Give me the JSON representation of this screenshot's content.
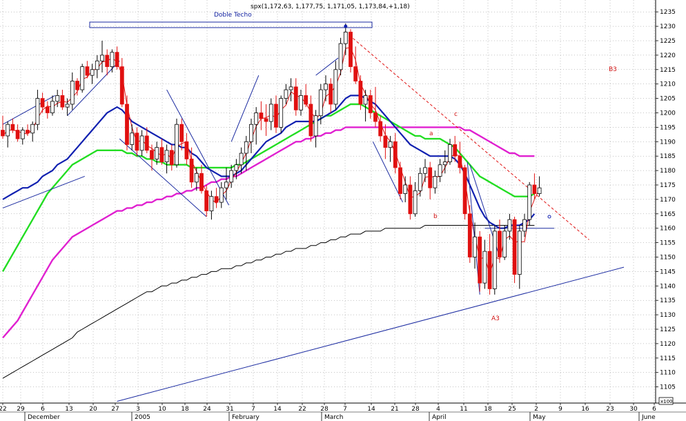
{
  "chart_data": {
    "type": "candlestick",
    "title": "spx(1,172,63, 1,177,75, 1,171,05, 1,173,84,+1,18)",
    "pattern_label": "Doble Techo",
    "ylim": [
      1100,
      1240
    ],
    "y_ticks": [
      1105,
      1110,
      1115,
      1120,
      1125,
      1130,
      1135,
      1140,
      1145,
      1150,
      1155,
      1160,
      1165,
      1170,
      1175,
      1180,
      1185,
      1190,
      1195,
      1200,
      1205,
      1210,
      1215,
      1220,
      1225,
      1230,
      1235
    ],
    "x_day_ticks": [
      "22",
      "29",
      "6",
      "13",
      "20",
      "27",
      "3",
      "10",
      "18",
      "24",
      "31",
      "7",
      "14",
      "22",
      "28",
      "7",
      "14",
      "21",
      "28",
      "4",
      "11",
      "18",
      "25",
      "2",
      "9",
      "16",
      "23",
      "30",
      "6"
    ],
    "x_month_labels": [
      "December",
      "2005",
      "February",
      "March",
      "April",
      "May",
      "June"
    ],
    "scale_box": "x100",
    "annotations": [
      {
        "text": "B3",
        "color": "red"
      },
      {
        "text": "c",
        "color": "red"
      },
      {
        "text": "a",
        "color": "red"
      },
      {
        "text": "b",
        "color": "red"
      },
      {
        "text": "A3",
        "color": "red"
      }
    ],
    "colors": {
      "bear_candle": "#e01010",
      "bull_candle": "#ffffff",
      "ma_fast": "#e01010",
      "ma_blue": "#1020b0",
      "ma_green": "#22dd22",
      "ma_magenta": "#e020d0",
      "ma_black": "#000000",
      "trendline": "#1a2aa0",
      "resistance": "#e01010"
    },
    "candles": [
      [
        1194,
        1199,
        1191,
        1192
      ],
      [
        1192,
        1197,
        1188,
        1196
      ],
      [
        1196,
        1198,
        1193,
        1194
      ],
      [
        1194,
        1196,
        1190,
        1191
      ],
      [
        1191,
        1195,
        1189,
        1194
      ],
      [
        1194,
        1196,
        1192,
        1193
      ],
      [
        1193,
        1197,
        1190,
        1196
      ],
      [
        1196,
        1208,
        1194,
        1205
      ],
      [
        1205,
        1207,
        1200,
        1202
      ],
      [
        1202,
        1204,
        1198,
        1200
      ],
      [
        1200,
        1206,
        1199,
        1204
      ],
      [
        1204,
        1208,
        1202,
        1206
      ],
      [
        1206,
        1208,
        1201,
        1202
      ],
      [
        1202,
        1205,
        1199,
        1203
      ],
      [
        1203,
        1214,
        1201,
        1211
      ],
      [
        1211,
        1212,
        1206,
        1208
      ],
      [
        1208,
        1217,
        1207,
        1216
      ],
      [
        1216,
        1218,
        1212,
        1213
      ],
      [
        1213,
        1217,
        1210,
        1215
      ],
      [
        1215,
        1220,
        1212,
        1218
      ],
      [
        1218,
        1225,
        1214,
        1220
      ],
      [
        1220,
        1222,
        1213,
        1216
      ],
      [
        1216,
        1222,
        1214,
        1221
      ],
      [
        1221,
        1223,
        1215,
        1216
      ],
      [
        1216,
        1219,
        1202,
        1203
      ],
      [
        1203,
        1206,
        1187,
        1189
      ],
      [
        1189,
        1196,
        1187,
        1193
      ],
      [
        1193,
        1195,
        1185,
        1187
      ],
      [
        1187,
        1194,
        1185,
        1192
      ],
      [
        1192,
        1195,
        1186,
        1187
      ],
      [
        1187,
        1189,
        1180,
        1184
      ],
      [
        1184,
        1190,
        1182,
        1188
      ],
      [
        1188,
        1191,
        1182,
        1183
      ],
      [
        1183,
        1189,
        1179,
        1187
      ],
      [
        1187,
        1189,
        1180,
        1182
      ],
      [
        1182,
        1198,
        1181,
        1196
      ],
      [
        1196,
        1198,
        1187,
        1190
      ],
      [
        1190,
        1193,
        1182,
        1184
      ],
      [
        1184,
        1188,
        1174,
        1176
      ],
      [
        1176,
        1181,
        1173,
        1179
      ],
      [
        1179,
        1182,
        1172,
        1173
      ],
      [
        1173,
        1175,
        1164,
        1166
      ],
      [
        1166,
        1173,
        1163,
        1171
      ],
      [
        1171,
        1174,
        1167,
        1169
      ],
      [
        1169,
        1176,
        1167,
        1174
      ],
      [
        1174,
        1181,
        1170,
        1176
      ],
      [
        1176,
        1182,
        1174,
        1180
      ],
      [
        1180,
        1184,
        1177,
        1182
      ],
      [
        1182,
        1188,
        1179,
        1186
      ],
      [
        1186,
        1192,
        1180,
        1190
      ],
      [
        1190,
        1198,
        1186,
        1196
      ],
      [
        1196,
        1202,
        1189,
        1200
      ],
      [
        1200,
        1204,
        1194,
        1198
      ],
      [
        1198,
        1203,
        1192,
        1197
      ],
      [
        1197,
        1205,
        1194,
        1203
      ],
      [
        1203,
        1206,
        1193,
        1195
      ],
      [
        1195,
        1206,
        1193,
        1205
      ],
      [
        1205,
        1210,
        1203,
        1208
      ],
      [
        1208,
        1212,
        1204,
        1209
      ],
      [
        1209,
        1212,
        1199,
        1201
      ],
      [
        1201,
        1208,
        1199,
        1206
      ],
      [
        1206,
        1210,
        1202,
        1203
      ],
      [
        1203,
        1206,
        1190,
        1192
      ],
      [
        1192,
        1201,
        1188,
        1199
      ],
      [
        1199,
        1210,
        1196,
        1208
      ],
      [
        1208,
        1213,
        1204,
        1210
      ],
      [
        1210,
        1212,
        1200,
        1203
      ],
      [
        1203,
        1218,
        1201,
        1215
      ],
      [
        1215,
        1226,
        1213,
        1224
      ],
      [
        1224,
        1231,
        1220,
        1228
      ],
      [
        1228,
        1229,
        1214,
        1216
      ],
      [
        1216,
        1223,
        1210,
        1211
      ],
      [
        1211,
        1213,
        1201,
        1203
      ],
      [
        1203,
        1208,
        1197,
        1206
      ],
      [
        1206,
        1208,
        1198,
        1200
      ],
      [
        1200,
        1209,
        1195,
        1197
      ],
      [
        1197,
        1199,
        1190,
        1192
      ],
      [
        1192,
        1196,
        1184,
        1188
      ],
      [
        1188,
        1192,
        1183,
        1190
      ],
      [
        1190,
        1193,
        1179,
        1181
      ],
      [
        1181,
        1183,
        1170,
        1172
      ],
      [
        1172,
        1178,
        1169,
        1175
      ],
      [
        1175,
        1178,
        1163,
        1165
      ],
      [
        1165,
        1176,
        1164,
        1173
      ],
      [
        1173,
        1181,
        1171,
        1179
      ],
      [
        1179,
        1184,
        1176,
        1181
      ],
      [
        1181,
        1183,
        1170,
        1174
      ],
      [
        1174,
        1180,
        1172,
        1178
      ],
      [
        1178,
        1184,
        1176,
        1182
      ],
      [
        1182,
        1187,
        1179,
        1183
      ],
      [
        1183,
        1191,
        1182,
        1189
      ],
      [
        1189,
        1192,
        1183,
        1185
      ],
      [
        1185,
        1190,
        1179,
        1181
      ],
      [
        1181,
        1182,
        1163,
        1165
      ],
      [
        1165,
        1168,
        1148,
        1150
      ],
      [
        1150,
        1162,
        1146,
        1157
      ],
      [
        1157,
        1159,
        1138,
        1141
      ],
      [
        1141,
        1156,
        1139,
        1152
      ],
      [
        1152,
        1158,
        1137,
        1139
      ],
      [
        1139,
        1161,
        1137,
        1159
      ],
      [
        1159,
        1163,
        1148,
        1150
      ],
      [
        1150,
        1161,
        1149,
        1159
      ],
      [
        1159,
        1165,
        1156,
        1163
      ],
      [
        1163,
        1164,
        1141,
        1144
      ],
      [
        1144,
        1161,
        1139,
        1159
      ],
      [
        1159,
        1165,
        1157,
        1163
      ],
      [
        1163,
        1176,
        1161,
        1175
      ],
      [
        1175,
        1179,
        1170,
        1172
      ],
      [
        1172,
        1178,
        1171,
        1174
      ]
    ],
    "ma_blue": [
      1170,
      1171,
      1172,
      1173,
      1174,
      1174,
      1175,
      1176,
      1178,
      1179,
      1180,
      1182,
      1183,
      1184,
      1186,
      1188,
      1190,
      1192,
      1194,
      1196,
      1198,
      1200,
      1201,
      1202,
      1201,
      1199,
      1197,
      1196,
      1195,
      1194,
      1193,
      1192,
      1191,
      1190,
      1189,
      1189,
      1188,
      1188,
      1186,
      1185,
      1183,
      1181,
      1180,
      1179,
      1178,
      1178,
      1178,
      1179,
      1180,
      1182,
      1184,
      1186,
      1188,
      1190,
      1191,
      1192,
      1193,
      1195,
      1196,
      1197,
      1197,
      1197,
      1197,
      1197,
      1198,
      1199,
      1200,
      1201,
      1203,
      1205,
      1206,
      1206,
      1206,
      1205,
      1204,
      1203,
      1201,
      1199,
      1197,
      1195,
      1193,
      1191,
      1189,
      1188,
      1187,
      1186,
      1185,
      1185,
      1185,
      1185,
      1185,
      1184,
      1182,
      1179,
      1175,
      1171,
      1167,
      1164,
      1162,
      1161,
      1160,
      1160,
      1161,
      1161,
      1161,
      1162,
      1163,
      1165
    ],
    "ma_green": [
      1145,
      1148,
      1151,
      1154,
      1157,
      1160,
      1163,
      1166,
      1169,
      1172,
      1174,
      1176,
      1178,
      1180,
      1182,
      1183,
      1184,
      1185,
      1186,
      1187,
      1187,
      1187,
      1187,
      1187,
      1187,
      1186,
      1186,
      1185,
      1185,
      1184,
      1184,
      1183,
      1183,
      1182,
      1182,
      1182,
      1182,
      1182,
      1181,
      1181,
      1181,
      1181,
      1181,
      1181,
      1181,
      1181,
      1181,
      1182,
      1182,
      1183,
      1184,
      1185,
      1186,
      1187,
      1188,
      1189,
      1190,
      1191,
      1192,
      1193,
      1194,
      1195,
      1196,
      1197,
      1198,
      1199,
      1199,
      1200,
      1201,
      1202,
      1203,
      1203,
      1203,
      1202,
      1201,
      1200,
      1199,
      1198,
      1197,
      1196,
      1195,
      1194,
      1193,
      1192,
      1192,
      1191,
      1191,
      1191,
      1191,
      1190,
      1189,
      1188,
      1186,
      1184,
      1182,
      1180,
      1178,
      1177,
      1176,
      1175,
      1174,
      1173,
      1172,
      1171,
      1171,
      1171,
      1171,
      1172
    ],
    "ma_magenta": [
      1122,
      1124,
      1126,
      1128,
      1131,
      1134,
      1137,
      1140,
      1143,
      1146,
      1149,
      1151,
      1153,
      1155,
      1157,
      1158,
      1159,
      1160,
      1161,
      1162,
      1163,
      1164,
      1165,
      1166,
      1166,
      1167,
      1167,
      1168,
      1168,
      1169,
      1169,
      1170,
      1170,
      1171,
      1171,
      1172,
      1172,
      1173,
      1173,
      1174,
      1174,
      1175,
      1176,
      1176,
      1177,
      1177,
      1178,
      1178,
      1179,
      1180,
      1181,
      1182,
      1183,
      1184,
      1185,
      1186,
      1187,
      1188,
      1189,
      1190,
      1190,
      1191,
      1191,
      1192,
      1192,
      1193,
      1193,
      1194,
      1194,
      1195,
      1195,
      1195,
      1195,
      1195,
      1195,
      1195,
      1195,
      1195,
      1195,
      1195,
      1195,
      1195,
      1195,
      1195,
      1195,
      1195,
      1195,
      1195,
      1195,
      1195,
      1195,
      1195,
      1195,
      1194,
      1194,
      1193,
      1192,
      1191,
      1190,
      1189,
      1188,
      1187,
      1186,
      1186,
      1185,
      1185,
      1185,
      1185
    ],
    "ma_black": [
      1108,
      1109,
      1110,
      1111,
      1112,
      1113,
      1114,
      1115,
      1116,
      1117,
      1118,
      1119,
      1120,
      1121,
      1122,
      1124,
      1125,
      1126,
      1127,
      1128,
      1129,
      1130,
      1131,
      1132,
      1133,
      1134,
      1135,
      1136,
      1137,
      1138,
      1138,
      1139,
      1140,
      1140,
      1141,
      1141,
      1142,
      1142,
      1143,
      1143,
      1144,
      1144,
      1145,
      1145,
      1146,
      1146,
      1146,
      1147,
      1147,
      1148,
      1148,
      1149,
      1149,
      1150,
      1150,
      1151,
      1151,
      1152,
      1152,
      1153,
      1153,
      1153,
      1154,
      1154,
      1155,
      1155,
      1156,
      1156,
      1157,
      1157,
      1158,
      1158,
      1158,
      1159,
      1159,
      1159,
      1159,
      1160,
      1160,
      1160,
      1160,
      1160,
      1160,
      1160,
      1160,
      1161,
      1161,
      1161,
      1161,
      1161,
      1161,
      1161,
      1161,
      1161,
      1161,
      1161,
      1161,
      1161,
      1161,
      1161,
      1161,
      1161,
      1161,
      1161,
      1161,
      1161,
      1161,
      1161
    ]
  }
}
